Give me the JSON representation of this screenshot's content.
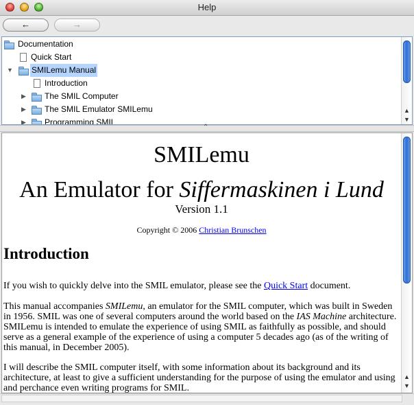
{
  "window": {
    "title": "Help"
  },
  "toolbar": {
    "back_label": "←",
    "forward_label": "→"
  },
  "tree": {
    "items": [
      {
        "label": "Documentation",
        "icon": "folder-icon"
      },
      {
        "label": "Quick Start",
        "icon": "document-icon"
      },
      {
        "label": "SMILemu Manual",
        "icon": "folder-icon",
        "disclosure": "▼",
        "selected": true
      },
      {
        "label": "Introduction",
        "icon": "document-icon"
      },
      {
        "label": "The SMIL Computer",
        "icon": "folder-icon",
        "disclosure": "▶"
      },
      {
        "label": "The SMIL Emulator SMILemu",
        "icon": "folder-icon",
        "disclosure": "▶"
      },
      {
        "label": "Programming SMIL",
        "icon": "folder-icon",
        "disclosure": "▶"
      }
    ]
  },
  "content": {
    "title": "SMILemu",
    "subtitle_prefix": "An Emulator for ",
    "subtitle_italic": "Siffermaskinen i Lund",
    "version": "Version 1.1",
    "copyright_prefix": "Copyright © 2006 ",
    "author_link": "Christian Brunschen",
    "heading": "Introduction",
    "p1_before": "If you wish to quickly delve into the SMIL emulator, please see the ",
    "p1_link": "Quick Start",
    "p1_after": " document.",
    "p2_a": "This manual accompanies ",
    "p2_em1": "SMILemu",
    "p2_b": ", an emulator for the SMIL computer, which was built in Sweden in 1956. SMIL was one of several computers around the world based on the ",
    "p2_em2": "IAS Machine",
    "p2_c": " architecture. SMILemu is intended to emulate the experience of using SMIL as faithfully as possible, and should serve as a general example of the experience of using a computer 5 decades ago (as of the writing of this manual, in December 2005).",
    "p3": "I will describe the SMIL computer itself, with some information about its background and its architecture, at least to give a sufficient understanding for the purpose of using the emulator and using and perchance even writing programs for SMIL."
  }
}
